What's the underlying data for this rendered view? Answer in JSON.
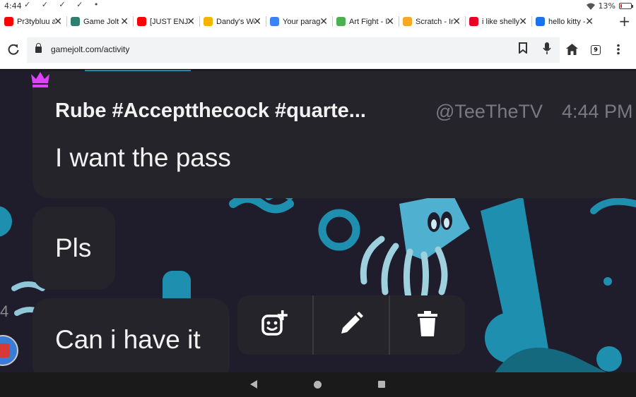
{
  "status": {
    "time": "4:44",
    "checks": "✓ ✓ ✓ ✓ •",
    "battery": "13%",
    "battery_level": 0.13
  },
  "tabs": [
    {
      "label": "Pr3tybluu a",
      "favicon": "youtube-icon",
      "color": "#ff0000"
    },
    {
      "label": "Game Jolt",
      "favicon": "gamejolt-icon",
      "color": "#2f7f6f"
    },
    {
      "label": "[JUST ENJ",
      "favicon": "youtube-icon",
      "color": "#ff0000"
    },
    {
      "label": "Dandy's Wo",
      "favicon": "fandom-icon",
      "color": "#f4b400"
    },
    {
      "label": "Your parag",
      "favicon": "app-icon",
      "color": "#3b82f6"
    },
    {
      "label": "Art Fight - I",
      "favicon": "artfight-icon",
      "color": "#4caf50"
    },
    {
      "label": "Scratch - Im",
      "favicon": "scratch-icon",
      "color": "#f9a825"
    },
    {
      "label": "i like shelly",
      "favicon": "pinterest-icon",
      "color": "#e60023"
    },
    {
      "label": "hello kitty -",
      "favicon": "app-icon",
      "color": "#1a73e8"
    }
  ],
  "address": {
    "url": "gamejolt.com/activity",
    "tab_count": "9"
  },
  "message": {
    "author": "Rube #Acceptthecock #quarte...",
    "handle": "@TeeTheTV",
    "time": "4:44 PM",
    "text": "I want the pass"
  },
  "bubbles": [
    {
      "text": "Pls"
    },
    {
      "text": "Can i have it"
    }
  ],
  "side_number": "4",
  "actions": [
    {
      "name": "add-reaction-button",
      "icon": "sticker-add-icon"
    },
    {
      "name": "edit-button",
      "icon": "pencil-icon"
    },
    {
      "name": "delete-button",
      "icon": "trash-icon"
    }
  ],
  "colors": {
    "accent_crown": "#e040fb",
    "bubble_bg": "#26242b",
    "background": "#1f1c2b",
    "illustration": "#1f8fb0"
  }
}
